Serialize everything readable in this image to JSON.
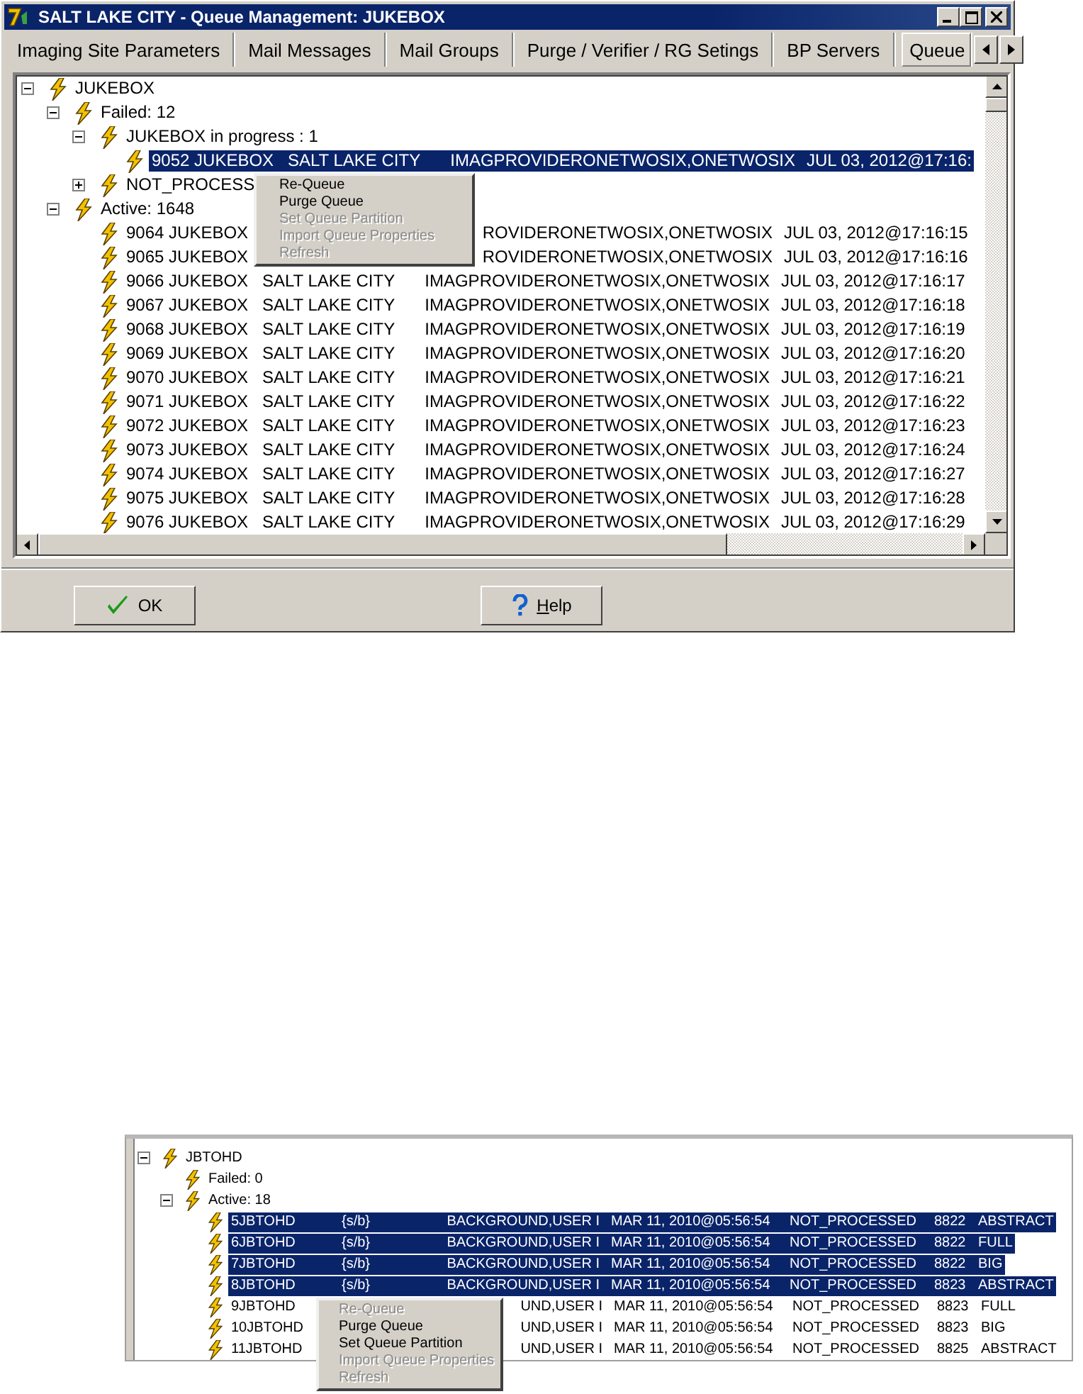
{
  "window": {
    "title": "SALT LAKE CITY - Queue Management: JUKEBOX"
  },
  "tabs": [
    {
      "label": "Imaging Site Parameters",
      "selected": false
    },
    {
      "label": "Mail Messages",
      "selected": false
    },
    {
      "label": "Mail Groups",
      "selected": false
    },
    {
      "label": "Purge / Verifier / RG Setings",
      "selected": false
    },
    {
      "label": "BP Servers",
      "selected": false
    },
    {
      "label": "Queue",
      "selected": true
    }
  ],
  "tree": [
    {
      "label": "JUKEBOX",
      "expanded": true,
      "selected": false,
      "children": [
        {
          "label": "Failed: 12",
          "expanded": true,
          "selected": false,
          "children": [
            {
              "label": "JUKEBOX in progress : 1",
              "expanded": true,
              "selected": false,
              "children": [
                {
                  "cells": [
                    "9052 JUKEBOX",
                    "SALT LAKE CITY",
                    "IMAGPROVIDERONETWOSIX,ONETWOSIX",
                    "JUL 03, 2012@17:16:"
                  ],
                  "selected": true
                }
              ]
            },
            {
              "label": "NOT_PROCESS",
              "expanded": false,
              "selected": false
            }
          ]
        },
        {
          "label": "Active: 1648",
          "expanded": true,
          "selected": false,
          "children": [
            {
              "cells": [
                "9064 JUKEBOX",
                null,
                "ROVIDERONETWOSIX,ONETWOSIX",
                "JUL 03, 2012@17:16:15"
              ],
              "selected": false
            },
            {
              "cells": [
                "9065 JUKEBOX",
                null,
                "ROVIDERONETWOSIX,ONETWOSIX",
                "JUL 03, 2012@17:16:16"
              ],
              "selected": false
            },
            {
              "cells": [
                "9066 JUKEBOX",
                "SALT LAKE CITY",
                "IMAGPROVIDERONETWOSIX,ONETWOSIX",
                "JUL 03, 2012@17:16:17"
              ],
              "selected": false
            },
            {
              "cells": [
                "9067 JUKEBOX",
                "SALT LAKE CITY",
                "IMAGPROVIDERONETWOSIX,ONETWOSIX",
                "JUL 03, 2012@17:16:18"
              ],
              "selected": false
            },
            {
              "cells": [
                "9068 JUKEBOX",
                "SALT LAKE CITY",
                "IMAGPROVIDERONETWOSIX,ONETWOSIX",
                "JUL 03, 2012@17:16:19"
              ],
              "selected": false
            },
            {
              "cells": [
                "9069 JUKEBOX",
                "SALT LAKE CITY",
                "IMAGPROVIDERONETWOSIX,ONETWOSIX",
                "JUL 03, 2012@17:16:20"
              ],
              "selected": false
            },
            {
              "cells": [
                "9070 JUKEBOX",
                "SALT LAKE CITY",
                "IMAGPROVIDERONETWOSIX,ONETWOSIX",
                "JUL 03, 2012@17:16:21"
              ],
              "selected": false
            },
            {
              "cells": [
                "9071 JUKEBOX",
                "SALT LAKE CITY",
                "IMAGPROVIDERONETWOSIX,ONETWOSIX",
                "JUL 03, 2012@17:16:22"
              ],
              "selected": false
            },
            {
              "cells": [
                "9072 JUKEBOX",
                "SALT LAKE CITY",
                "IMAGPROVIDERONETWOSIX,ONETWOSIX",
                "JUL 03, 2012@17:16:23"
              ],
              "selected": false
            },
            {
              "cells": [
                "9073 JUKEBOX",
                "SALT LAKE CITY",
                "IMAGPROVIDERONETWOSIX,ONETWOSIX",
                "JUL 03, 2012@17:16:24"
              ],
              "selected": false
            },
            {
              "cells": [
                "9074 JUKEBOX",
                "SALT LAKE CITY",
                "IMAGPROVIDERONETWOSIX,ONETWOSIX",
                "JUL 03, 2012@17:16:27"
              ],
              "selected": false
            },
            {
              "cells": [
                "9075 JUKEBOX",
                "SALT LAKE CITY",
                "IMAGPROVIDERONETWOSIX,ONETWOSIX",
                "JUL 03, 2012@17:16:28"
              ],
              "selected": false
            },
            {
              "cells": [
                "9076 JUKEBOX",
                "SALT LAKE CITY",
                "IMAGPROVIDERONETWOSIX,ONETWOSIX",
                "JUL 03, 2012@17:16:29"
              ],
              "selected": false
            }
          ]
        }
      ]
    }
  ],
  "context_menu": [
    {
      "label": "Re-Queue",
      "disabled": false
    },
    {
      "label": "Purge Queue",
      "disabled": false
    },
    {
      "label": "Set Queue Partition",
      "disabled": true
    },
    {
      "label": "Import Queue Properties",
      "disabled": true
    },
    {
      "label": "Refresh",
      "disabled": true
    }
  ],
  "buttons": [
    {
      "label": "OK",
      "kind": "ok",
      "mnemonic": false
    },
    {
      "label": "Help",
      "kind": "help",
      "mnemonic": true
    }
  ],
  "second_screenshot": {
    "tree": [
      {
        "label": "JBTOHD",
        "expanded": true,
        "selected": false,
        "children": [
          {
            "label": "Failed: 0",
            "selected": false
          },
          {
            "label": "Active: 18",
            "expanded": true,
            "selected": false,
            "children": [
              {
                "cells": [
                  "5JBTOHD",
                  "{s/b}",
                  "BACKGROUND,USER I",
                  "MAR 11, 2010@05:56:54",
                  "NOT_PROCESSED",
                  "8822",
                  "ABSTRACT"
                ],
                "selected": true
              },
              {
                "cells": [
                  "6JBTOHD",
                  "{s/b}",
                  "BACKGROUND,USER I",
                  "MAR 11, 2010@05:56:54",
                  "NOT_PROCESSED",
                  "8822",
                  "FULL"
                ],
                "selected": true
              },
              {
                "cells": [
                  "7JBTOHD",
                  "{s/b}",
                  "BACKGROUND,USER I",
                  "MAR 11, 2010@05:56:54",
                  "NOT_PROCESSED",
                  "8822",
                  "BIG"
                ],
                "selected": true
              },
              {
                "cells": [
                  "8JBTOHD",
                  "{s/b}",
                  "BACKGROUND,USER I",
                  "MAR 11, 2010@05:56:54",
                  "NOT_PROCESSED",
                  "8823",
                  "ABSTRACT"
                ],
                "selected": true
              },
              {
                "cells": [
                  "9JBTOHD",
                  null,
                  "UND,USER I",
                  "MAR 11, 2010@05:56:54",
                  "NOT_PROCESSED",
                  "8823",
                  "FULL"
                ],
                "selected": false
              },
              {
                "cells": [
                  "10JBTOHD",
                  null,
                  "UND,USER I",
                  "MAR 11, 2010@05:56:54",
                  "NOT_PROCESSED",
                  "8823",
                  "BIG"
                ],
                "selected": false
              },
              {
                "cells": [
                  "11JBTOHD",
                  null,
                  "UND,USER I",
                  "MAR 11, 2010@05:56:54",
                  "NOT_PROCESSED",
                  "8825",
                  "ABSTRACT"
                ],
                "selected": false
              }
            ]
          }
        ]
      }
    ],
    "context_menu": [
      {
        "label": "Re-Queue",
        "disabled": true
      },
      {
        "label": "Purge Queue",
        "disabled": false
      },
      {
        "label": "Set Queue Partition",
        "disabled": false
      },
      {
        "label": "Import Queue Properties",
        "disabled": true
      },
      {
        "label": "Refresh",
        "disabled": true
      }
    ]
  }
}
